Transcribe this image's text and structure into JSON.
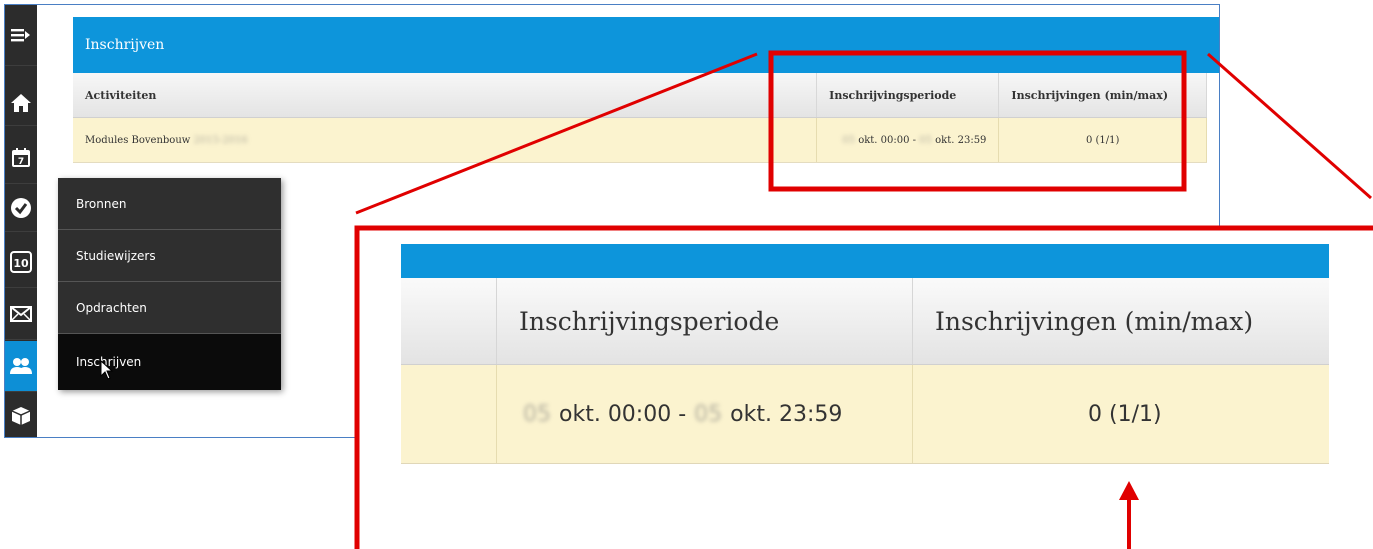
{
  "page": {
    "title": "Inschrijven"
  },
  "table": {
    "headers": {
      "activities": "Activiteiten",
      "period": "Inschrijvingsperiode",
      "enrollments": "Inschrijvingen (min/max)"
    },
    "rows": [
      {
        "activity": "Modules Bovenbouw",
        "activity_year": "2015-2016",
        "period_day_start": "05",
        "period_start": "okt. 00:00 -",
        "period_day_end": "05",
        "period_end": "okt. 23:59",
        "enrollments": "0 (1/1)"
      }
    ]
  },
  "sidebar": {
    "icons": [
      "menu-icon",
      "home-icon",
      "calendar-icon",
      "check-icon",
      "grade-icon",
      "mail-icon",
      "people-icon",
      "box-icon"
    ],
    "calendar_number": "7",
    "grade_number": "10"
  },
  "flyout": {
    "items": [
      {
        "label": "Bronnen"
      },
      {
        "label": "Studiewijzers"
      },
      {
        "label": "Opdrachten"
      },
      {
        "label": "Inschrijven",
        "active": true
      }
    ]
  },
  "colors": {
    "header_blue": "#0d95db",
    "row_yellow": "#fbf3cf",
    "sidebar_dark": "#2c2c2c",
    "annotation_red": "#e00000"
  }
}
